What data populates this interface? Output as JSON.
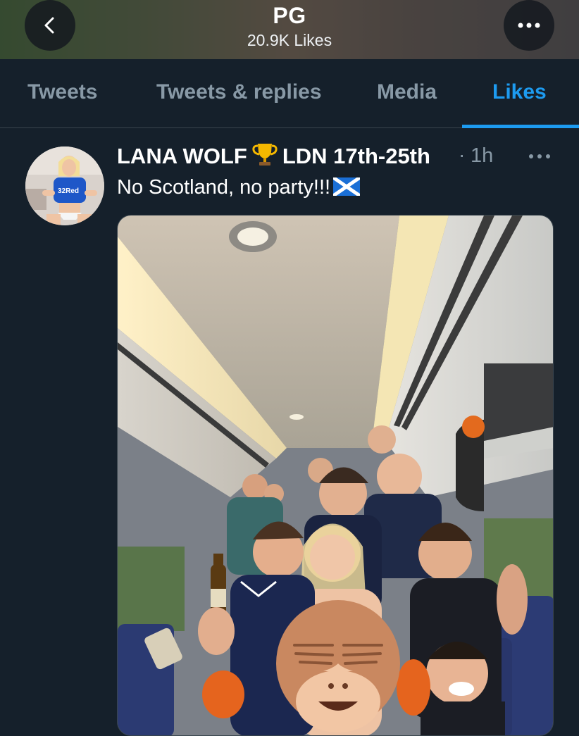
{
  "header": {
    "title": "PG",
    "subtitle": "20.9K Likes",
    "back_icon": "chevron-left-icon",
    "more_icon": "more-horizontal-icon"
  },
  "tabs": [
    {
      "label": "Tweets",
      "active": false
    },
    {
      "label": "Tweets & replies",
      "active": false
    },
    {
      "label": "Media",
      "active": false
    },
    {
      "label": "Likes",
      "active": true
    }
  ],
  "tweet": {
    "display_name_part1": "LANA WOLF",
    "display_name_part2": "LDN 17th-25th",
    "name_emoji": "trophy-icon",
    "separator": "·",
    "time": "1h",
    "text": "No Scotland, no party!!!",
    "text_emoji": "scotland-flag-icon",
    "media_description": "photo"
  },
  "colors": {
    "background": "#15202b",
    "accent": "#1d9bf0",
    "muted": "#8899a6",
    "divider": "#38444d"
  }
}
